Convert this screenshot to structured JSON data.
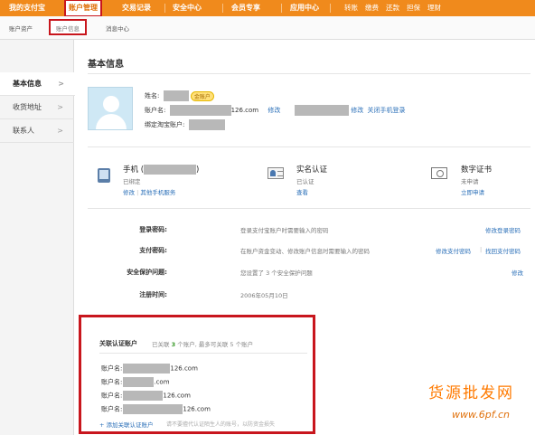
{
  "topnav": {
    "items": [
      {
        "label": "我的支付宝"
      },
      {
        "label": "账户管理"
      },
      {
        "label": "交易记录"
      },
      {
        "label": "安全中心"
      },
      {
        "label": "会员专享"
      },
      {
        "label": "应用中心"
      }
    ],
    "quick": [
      "转账",
      "缴费",
      "还款",
      "担保",
      "理财"
    ]
  },
  "subnav": {
    "items": [
      {
        "label": "账户资产"
      },
      {
        "label": "账户信息"
      },
      {
        "label": "消息中心"
      }
    ]
  },
  "sidebar": {
    "items": [
      {
        "label": "基本信息"
      },
      {
        "label": "收货地址"
      },
      {
        "label": "联系人"
      }
    ]
  },
  "main": {
    "title": "基本信息",
    "profile": {
      "name_label": "姓名:",
      "badge": "金账户",
      "account_label": "账户名:",
      "account_suffix": "126.com",
      "modify": "修改",
      "close_mobile_login": "关闭手机登录",
      "taobao_label": "绑定淘宝账户:"
    },
    "cards": {
      "phone": {
        "title": "手机 (",
        "title_end": ")",
        "status": "已绑定",
        "link1": "修改",
        "link2": "其他手机服务"
      },
      "realname": {
        "title": "实名认证",
        "status": "已认证",
        "link1": "查看"
      },
      "cert": {
        "title": "数字证书",
        "status": "未申请",
        "link1": "立即申请"
      }
    },
    "security_rows": [
      {
        "label": "登录密码:",
        "desc": "登录支付宝账户时需要输入的密码",
        "actions": [
          "修改登录密码"
        ]
      },
      {
        "label": "支付密码:",
        "desc": "在账户资金变动、修改账户信息时需要输入的密码",
        "actions": [
          "修改支付密码",
          "找回支付密码"
        ]
      },
      {
        "label": "安全保护问题:",
        "desc": "您设置了 3 个安全保护问题",
        "actions": [
          "修改"
        ]
      },
      {
        "label": "注册时间:",
        "desc": "2006年05月10日",
        "actions": []
      }
    ],
    "linked": {
      "title": "关联认证账户",
      "meta_prefix": "已关联",
      "meta_count": "3",
      "meta_suffix": "个账户, 最多可关联 5 个账户",
      "accounts": [
        {
          "label": "账户名:",
          "suffix": "126.com"
        },
        {
          "label": "账户名:",
          "suffix": ".com"
        },
        {
          "label": "账户名:",
          "suffix": "126.com"
        },
        {
          "label": "账户名:",
          "suffix": "126.com"
        }
      ],
      "add_label": "+ 添加关联认证账户",
      "add_note": "请不要擅代认证陌生人的账号，以防资金损失"
    }
  },
  "watermark": {
    "line1": "货源批发网",
    "line2": "www.6pf.cn"
  }
}
